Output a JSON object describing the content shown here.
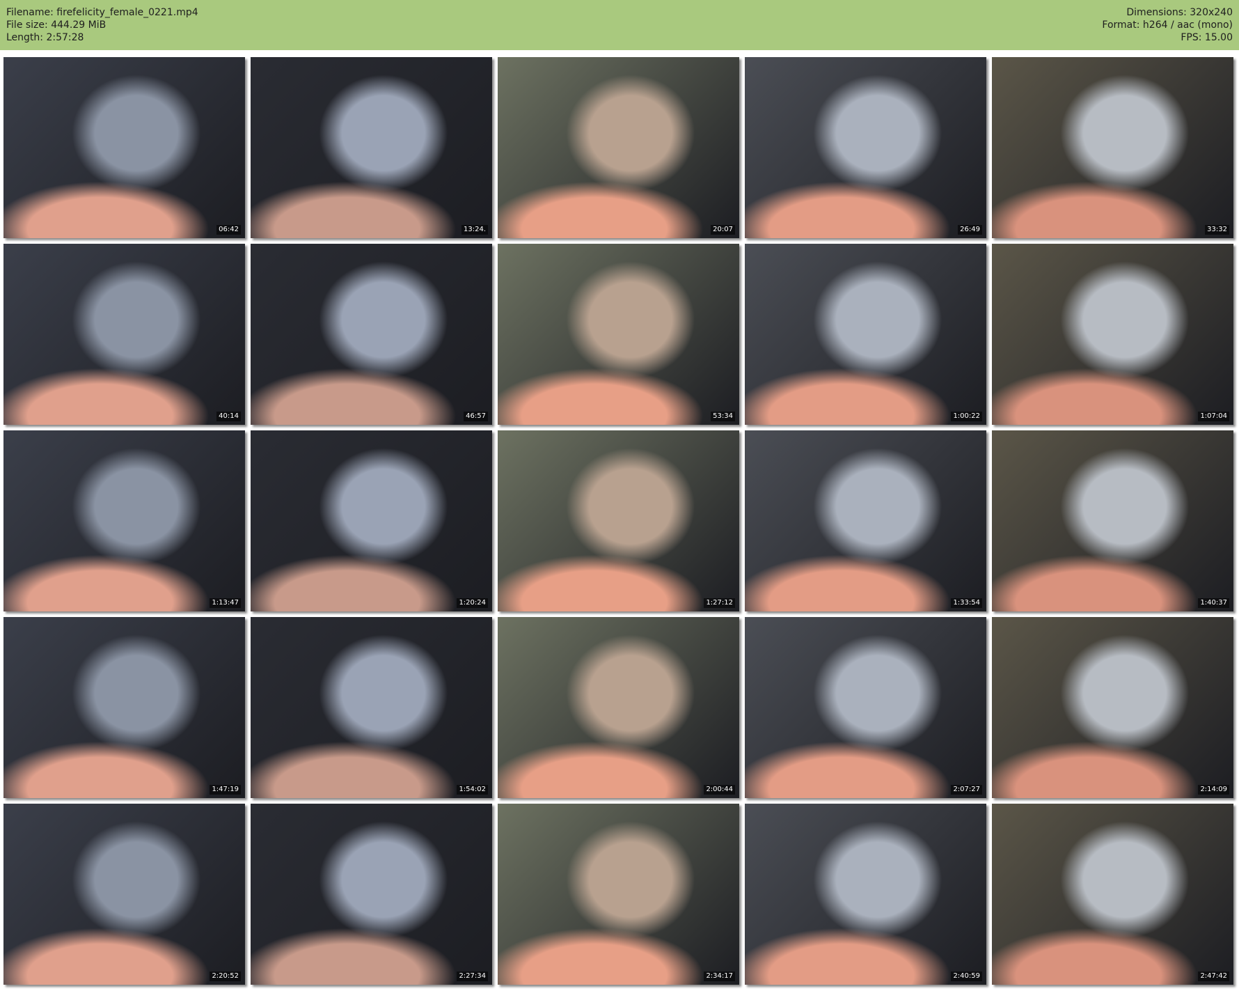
{
  "header": {
    "filename": "Filename: firefelicity_female_0221.mp4",
    "filesize": "File size: 444.29 MiB",
    "length": "Length: 2:57:28",
    "dimensions": "Dimensions: 320x240",
    "format": "Format: h264 / aac (mono)",
    "fps": "FPS: 15.00",
    "background_color": "#a9c97e"
  },
  "thumbnails": [
    {
      "timestamp": "06:42"
    },
    {
      "timestamp": "13:24."
    },
    {
      "timestamp": "20:07"
    },
    {
      "timestamp": "26:49"
    },
    {
      "timestamp": "33:32"
    },
    {
      "timestamp": "40:14"
    },
    {
      "timestamp": "46:57"
    },
    {
      "timestamp": "53:34"
    },
    {
      "timestamp": "1:00:22"
    },
    {
      "timestamp": "1:07:04"
    },
    {
      "timestamp": "1:13:47"
    },
    {
      "timestamp": "1:20:24"
    },
    {
      "timestamp": "1:27:12"
    },
    {
      "timestamp": "1:33:54"
    },
    {
      "timestamp": "1:40:37"
    },
    {
      "timestamp": "1:47:19"
    },
    {
      "timestamp": "1:54:02"
    },
    {
      "timestamp": "2:00:44"
    },
    {
      "timestamp": "2:07:27"
    },
    {
      "timestamp": "2:14:09"
    },
    {
      "timestamp": "2:20:52"
    },
    {
      "timestamp": "2:27:34"
    },
    {
      "timestamp": "2:34:17"
    },
    {
      "timestamp": "2:40:59"
    },
    {
      "timestamp": "2:47:42"
    }
  ]
}
